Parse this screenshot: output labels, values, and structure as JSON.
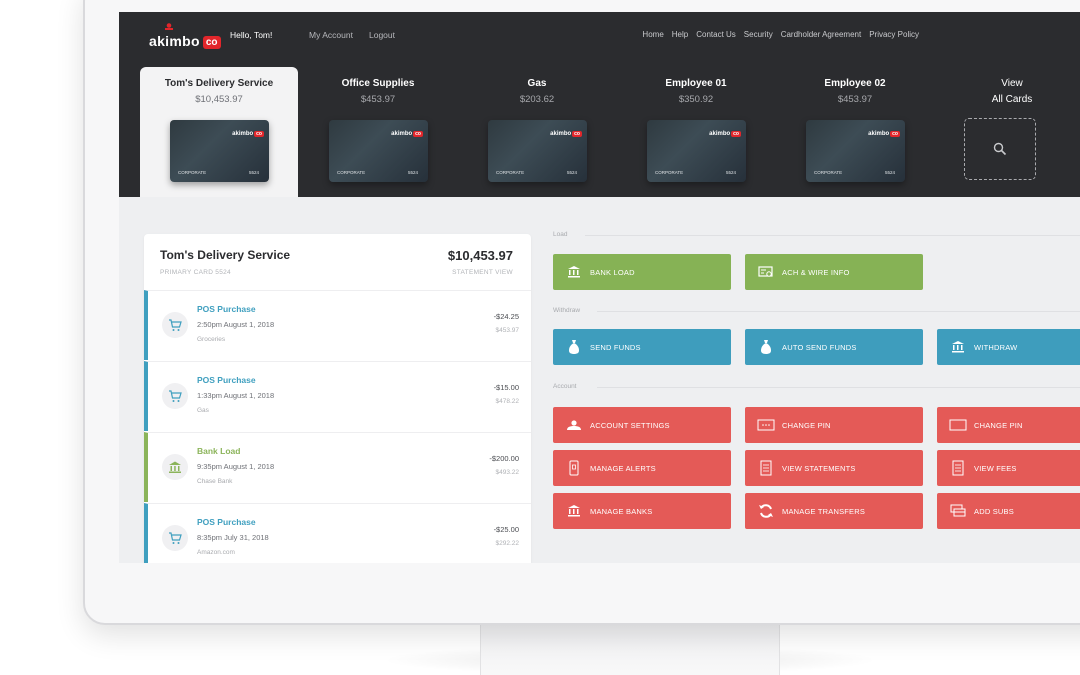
{
  "header": {
    "logo_text": "akimbo",
    "logo_badge": "co",
    "greeting": "Hello, Tom!",
    "my_account": "My Account",
    "logout": "Logout",
    "nav": [
      "Home",
      "Help",
      "Contact Us",
      "Security",
      "Cardholder Agreement",
      "Privacy Policy"
    ]
  },
  "card_tabs": [
    {
      "name": "Tom's Delivery Service",
      "amount": "$10,453.97",
      "active": true
    },
    {
      "name": "Office Supplies",
      "amount": "$453.97"
    },
    {
      "name": "Gas",
      "amount": "$203.62"
    },
    {
      "name": "Employee 01",
      "amount": "$350.92"
    },
    {
      "name": "Employee 02",
      "amount": "$453.97"
    }
  ],
  "card_face": {
    "logo": "akimbo",
    "badge": "co",
    "type": "CORPORATE",
    "last4": "5524"
  },
  "view_all": {
    "line1": "View",
    "line2": "All Cards"
  },
  "account": {
    "name": "Tom's Delivery Service",
    "total": "$10,453.97",
    "subtitle": "PRIMARY CARD 5524",
    "statement_view": "STATEMENT VIEW"
  },
  "transactions": [
    {
      "type": "POS Purchase",
      "time": "2:50pm August 1, 2018",
      "category": "Groceries",
      "amount": "-$24.25",
      "balance": "$453.97",
      "kind": "pos"
    },
    {
      "type": "POS Purchase",
      "time": "1:33pm August 1, 2018",
      "category": "Gas",
      "amount": "-$15.00",
      "balance": "$478.22",
      "kind": "pos"
    },
    {
      "type": "Bank Load",
      "time": "9:35pm August 1, 2018",
      "category": "Chase Bank",
      "amount": "-$200.00",
      "balance": "$493.22",
      "kind": "bank"
    },
    {
      "type": "POS Purchase",
      "time": "8:35pm July 31, 2018",
      "category": "Amazon.com",
      "amount": "-$25.00",
      "balance": "$292.22",
      "kind": "pos"
    }
  ],
  "sections": {
    "load": "Load",
    "withdraw": "Withdraw",
    "account": "Account"
  },
  "actions": {
    "bank_load": "BANK LOAD",
    "ach_wire": "ACH & WIRE INFO",
    "send_funds": "SEND FUNDS",
    "auto_send": "AUTO SEND FUNDS",
    "withdraw": "WITHDRAW",
    "account_settings": "ACCOUNT SETTINGS",
    "change_pin_1": "CHANGE PIN",
    "change_pin_2": "CHANGE PIN",
    "manage_alerts": "MANAGE ALERTS",
    "view_statements": "VIEW STATEMENTS",
    "view_fees": "VIEW FEES",
    "manage_banks": "MANAGE BANKS",
    "manage_transfers": "MANAGE TRANSFERS",
    "add_subs": "ADD SUBS"
  },
  "colors": {
    "load": "#86b255",
    "withdraw": "#3e9dbd",
    "account": "#e45a57",
    "header": "#2b2c2f"
  }
}
